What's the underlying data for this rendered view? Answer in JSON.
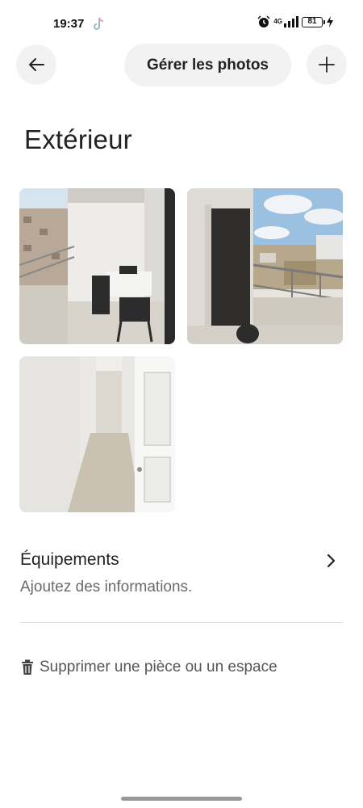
{
  "status_bar": {
    "time": "19:37",
    "network": "4G",
    "battery": "81",
    "icons": [
      "tiktok-icon",
      "alarm-icon",
      "signal-icon",
      "battery-icon",
      "charging-icon"
    ]
  },
  "top_bar": {
    "back_icon": "arrow-left-icon",
    "manage_label": "Gérer les photos",
    "add_icon": "plus-icon"
  },
  "page": {
    "title": "Extérieur"
  },
  "photos": [
    {
      "name": "balcony-table-chairs"
    },
    {
      "name": "balcony-city-view"
    },
    {
      "name": "hallway-door"
    }
  ],
  "amenities": {
    "title": "Équipements",
    "subtitle": "Ajoutez des informations.",
    "icon": "chevron-right-icon"
  },
  "delete": {
    "icon": "trash-icon",
    "label": "Supprimer une pièce ou un espace"
  },
  "colors": {
    "button_bg": "#f2f2f2",
    "text_primary": "#222222",
    "text_secondary": "#6a6a6a",
    "divider": "#dddddd"
  }
}
